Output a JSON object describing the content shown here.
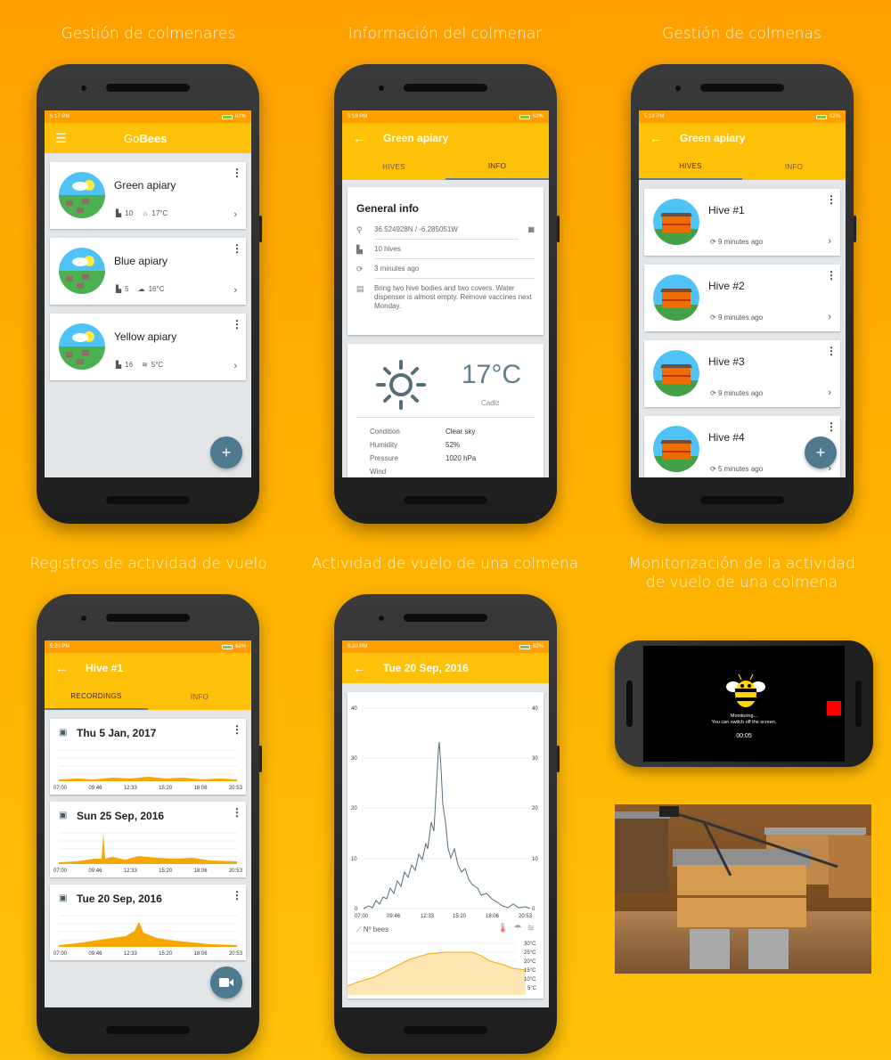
{
  "captions": {
    "c1": "Gestión de colmenares",
    "c2": "Información del colmenar",
    "c3": "Gestión de colmenas",
    "c4": "Registros de actividad de vuelo",
    "c5": "Actividad de vuelo de una colmena",
    "c6_line1": "Monitorización de la actividad",
    "c6_line2": "de vuelo de una colmena"
  },
  "colors": {
    "accent": "#ffc107",
    "status": "#ffa000",
    "fab": "#4f7a8e"
  },
  "phone1": {
    "time": "5:17 PM",
    "battery": "61%",
    "app_title_prefix": "Go",
    "app_title_bold": "Bees",
    "apiaries": [
      {
        "name": "Green apiary",
        "hives": "10",
        "weather_icon": "sun-icon",
        "temp": "17°C"
      },
      {
        "name": "Blue apiary",
        "hives": "5",
        "weather_icon": "cloud-icon",
        "temp": "16°C"
      },
      {
        "name": "Yellow apiary",
        "hives": "16",
        "weather_icon": "fog-icon",
        "temp": "5°C"
      }
    ],
    "fab": "+"
  },
  "phone2": {
    "time": "5:19 PM",
    "battery": "62%",
    "title": "Green apiary",
    "tabs": [
      "HIVES",
      "INFO"
    ],
    "active_tab": 1,
    "general_info_title": "General info",
    "location": "36.524928N / -6.285051W",
    "hives": "10 hives",
    "updated": "3 minutes ago",
    "notes": "Bring two hive bodies and two covers. Water dispenser is almost empty. Remove vaccines next Monday.",
    "weather": {
      "temp": "17°C",
      "city": "Cadiz",
      "rows": [
        {
          "k": "Condition",
          "v": "Clear sky"
        },
        {
          "k": "Humidity",
          "v": "52%"
        },
        {
          "k": "Pressure",
          "v": "1020 hPa"
        },
        {
          "k": "Wind",
          "v": ""
        }
      ]
    }
  },
  "phone3": {
    "time": "5:18 PM",
    "battery": "62%",
    "title": "Green apiary",
    "tabs": [
      "HIVES",
      "INFO"
    ],
    "active_tab": 0,
    "hives": [
      {
        "name": "Hive #1",
        "updated": "9 minutes ago"
      },
      {
        "name": "Hive #2",
        "updated": "9 minutes ago"
      },
      {
        "name": "Hive #3",
        "updated": "9 minutes ago"
      },
      {
        "name": "Hive #4",
        "updated": "5 minutes ago"
      }
    ],
    "fab": "+"
  },
  "phone4": {
    "time": "5:20 PM",
    "battery": "62%",
    "title": "Hive #1",
    "tabs": [
      "RECORDINGS",
      "INFO"
    ],
    "active_tab": 0,
    "recordings": [
      {
        "date": "Thu 5 Jan, 2017",
        "ticks": [
          "07:00",
          "09:46",
          "12:33",
          "15:20",
          "18:06",
          "20:53"
        ]
      },
      {
        "date": "Sun 25 Sep, 2016",
        "ticks": [
          "07:00",
          "09:46",
          "12:33",
          "15:20",
          "18:06",
          "20:53"
        ]
      },
      {
        "date": "Tue 20 Sep, 2016",
        "ticks": [
          "07:00",
          "09:46",
          "12:33",
          "15:20",
          "18:06",
          "20:53"
        ]
      }
    ]
  },
  "phone5": {
    "time": "5:20 PM",
    "battery": "62%",
    "title": "Tue 20 Sep, 2016",
    "legend": "Nº bees",
    "y_ticks": [
      "0",
      "10",
      "20",
      "30",
      "40"
    ],
    "x_ticks": [
      "07:00",
      "09:46",
      "12:33",
      "15:20",
      "18:06",
      "20:53"
    ],
    "temp_ticks": [
      "30°C",
      "25°C",
      "20°C",
      "15°C",
      "10°C",
      "5°C"
    ]
  },
  "monitor": {
    "status": "Monitoring...",
    "hint": "You can switch off the screen.",
    "timer": "00:05"
  }
}
